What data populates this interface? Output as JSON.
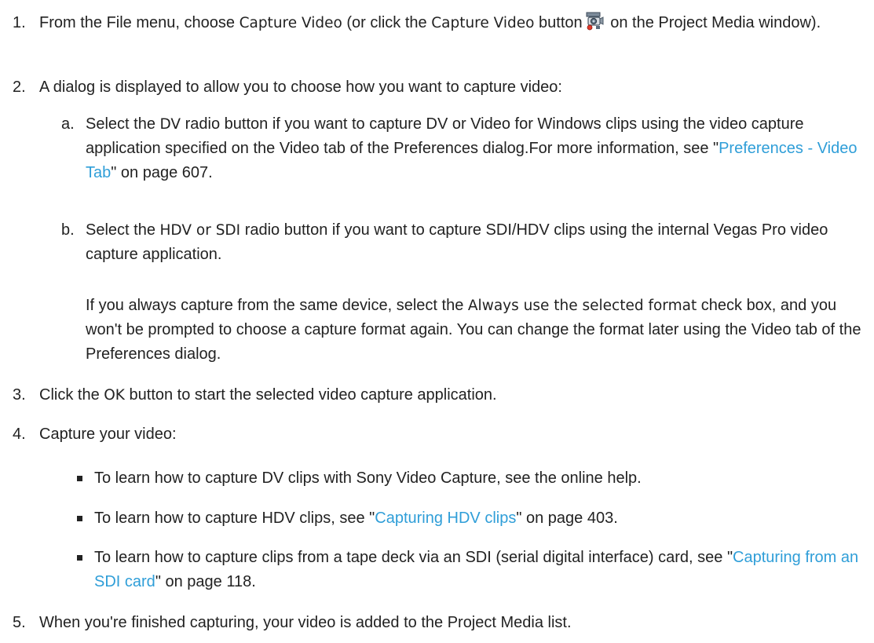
{
  "steps": [
    {
      "num": "1.",
      "t1": "From the File menu, choose ",
      "b1": "Capture Video",
      "t2": " (or click the ",
      "b2": "Capture Video",
      "t3": " button",
      "t4": " on the Project Media window)."
    },
    {
      "num": "2.",
      "text": "A dialog is displayed to allow you to choose how you want to capture video:",
      "subs": [
        {
          "letter": "a.",
          "t1": "Select the ",
          "b1": "DV",
          "t2": " radio button if you want to capture DV or Video for Windows clips using the video capture application specified on the Video tab of the Preferences dialog.For more information, see \"",
          "link": "Preferences - Video Tab",
          "t3": "\" on page 607."
        },
        {
          "letter": "b.",
          "t1": "Select the ",
          "b1": "HDV or SDI",
          "t2": " radio button if you want to capture SDI/HDV clips using the internal Vegas Pro video capture application."
        }
      ],
      "note": {
        "t1": "If you always capture from the same device, select the ",
        "b1": "Always use the selected format",
        "t2": " check box, and you won't be prompted to choose a capture format again. You can change the format later using the Video tab of the Preferences dialog."
      }
    },
    {
      "num": "3.",
      "t1": "Click the ",
      "b1": "OK",
      "t2": " button to start the selected video capture application."
    },
    {
      "num": "4.",
      "text": "Capture your video:",
      "bullets": [
        {
          "t1": "To learn how to capture DV clips with Sony Video Capture, see the online help."
        },
        {
          "t1": "To learn how to capture HDV clips, see \"",
          "link": "Capturing HDV clips",
          "t2": "\" on page 403."
        },
        {
          "t1": "To learn how to capture clips from a tape deck via an SDI (serial digital interface) card, see \"",
          "link": "Capturing from an SDI card",
          "t2": "\" on page 118."
        }
      ]
    },
    {
      "num": "5.",
      "text": "When you're finished capturing, your video is added to the Project Media list."
    }
  ],
  "icons": {
    "capture_video_button": "capture-video-camera-icon"
  },
  "colors": {
    "link": "#2f9ed8",
    "text": "#222222"
  }
}
